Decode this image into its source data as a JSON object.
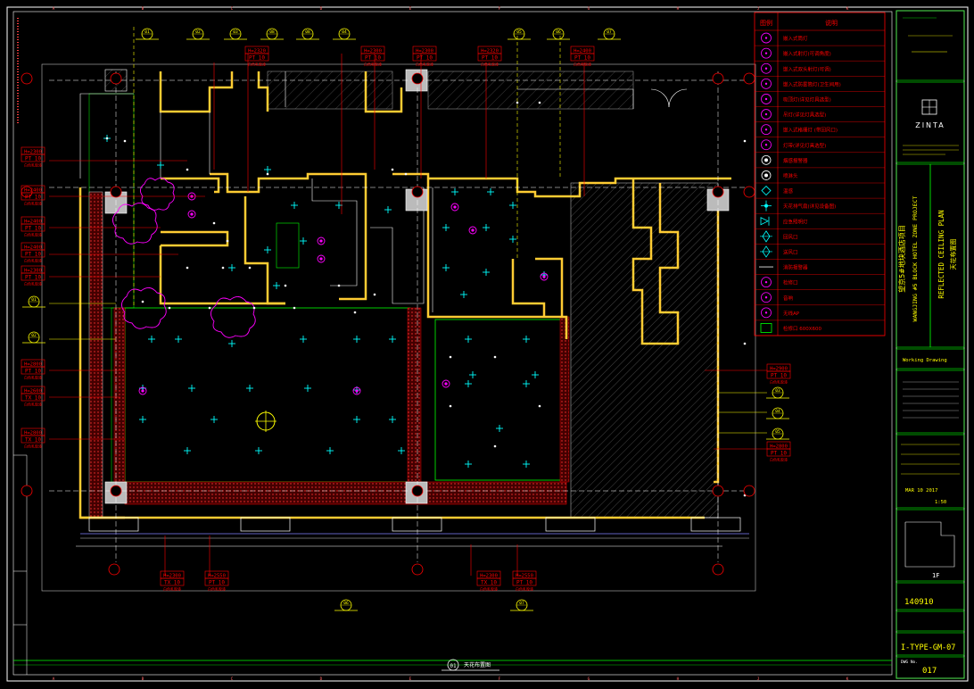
{
  "drawing": {
    "type": "reflected-ceiling-plan",
    "title_main": "REFLECTED CEILING PLAN",
    "title_sub": "天花布置图",
    "project_en": "WANGJING #5 BLOCK HOTEL ZONE PROJECT",
    "project_cn": "望京5#地块酒店项目",
    "firm": "ZINTA",
    "area_label": "Working Drawing",
    "project_no": "140910",
    "drawing_no": "I-TYPE-GM-07",
    "sheet_no": "017",
    "date": "MAR 10 2017",
    "level": "1F",
    "scale": "1:50",
    "sheet_label": "DWG No."
  },
  "legend": {
    "header_symbol": "图例",
    "header_desc": "说明",
    "items": [
      {
        "icon": "circle-f-icon",
        "color": "#ff00ff",
        "desc": "嵌入式筒灯"
      },
      {
        "icon": "circle-a-icon",
        "color": "#ff00ff",
        "desc": "嵌入式射灯(可调角度)"
      },
      {
        "icon": "circle-b-icon",
        "color": "#ff00ff",
        "desc": "嵌入式双头射灯(可调)"
      },
      {
        "icon": "circle-c-icon",
        "color": "#ff00ff",
        "desc": "嵌入式防雾筒灯(卫生间用)"
      },
      {
        "icon": "circle-d-icon",
        "color": "#ff00ff",
        "desc": "吸顶灯(详见灯具选型)"
      },
      {
        "icon": "circle-e-icon",
        "color": "#ff00ff",
        "desc": "吊灯(详见灯具选型)"
      },
      {
        "icon": "circle-g-icon",
        "color": "#ff00ff",
        "desc": "嵌入式格栅灯 (带回风口)"
      },
      {
        "icon": "circle-h-icon",
        "color": "#ff00ff",
        "desc": "灯带(详见灯具选型)"
      },
      {
        "icon": "speaker-icon",
        "color": "#ffffff",
        "desc": "烟感报警器"
      },
      {
        "icon": "sprinkler-icon",
        "color": "#ffffff",
        "desc": "喷淋头"
      },
      {
        "icon": "diamond-icon",
        "color": "#00ffff",
        "desc": "温感"
      },
      {
        "icon": "cross-icon",
        "color": "#00ffff",
        "desc": "天花排气扇(详见设备图)"
      },
      {
        "icon": "exit-icon",
        "color": "#00ffff",
        "desc": "应急照明灯"
      },
      {
        "icon": "vent-icon",
        "color": "#00ffff",
        "desc": "回风口"
      },
      {
        "icon": "supply-icon",
        "color": "#00ffff",
        "desc": "送风口"
      },
      {
        "icon": "line-icon",
        "color": "#ffffff",
        "desc": "消防报警器"
      },
      {
        "icon": "circle-p-icon",
        "color": "#ff00ff",
        "desc": "检修口"
      },
      {
        "icon": "circle-s-icon",
        "color": "#ff00ff",
        "desc": "音响"
      },
      {
        "icon": "circle-w-icon",
        "color": "#ff00ff",
        "desc": "无线AP"
      },
      {
        "icon": "square-icon",
        "color": "#00ff00",
        "desc": "检修口 600X600"
      }
    ]
  },
  "ceiling_tags": {
    "top": [
      {
        "h": "H=2320",
        "m": "PT 10",
        "s": "白色乳胶漆"
      },
      {
        "h": "H=2300",
        "m": "PT 10",
        "s": "白色乳胶漆"
      },
      {
        "h": "H=2300",
        "m": "PT 10",
        "s": "白色乳胶漆"
      },
      {
        "h": "H=2320",
        "m": "PT 10",
        "s": "白色乳胶漆"
      },
      {
        "h": "H=2400",
        "m": "PT 10",
        "s": "白色乳胶漆"
      }
    ],
    "left": [
      {
        "h": "H=2300",
        "m": "PT 10",
        "s": "白色乳胶漆"
      },
      {
        "h": "H=2400",
        "m": "PT 10",
        "s": "白色乳胶漆"
      },
      {
        "h": "H=2400",
        "m": "PT 10",
        "s": "白色乳胶漆"
      },
      {
        "h": "H=2400",
        "m": "PT 10",
        "s": "白色乳胶漆"
      },
      {
        "h": "H=2300",
        "m": "PT 10",
        "s": "白色乳胶漆"
      },
      {
        "h": "H=2800",
        "m": "PT 10",
        "s": "白色乳胶漆"
      },
      {
        "h": "H=2600",
        "m": "TX 10",
        "s": "白色乳胶漆"
      },
      {
        "h": "H=2800",
        "m": "TX 10",
        "s": "白色乳胶漆"
      }
    ],
    "right": [
      {
        "h": "H=2900",
        "m": "PT 10",
        "s": "白色乳胶漆"
      },
      {
        "h": "H=2800",
        "m": "PT 10",
        "s": "白色乳胶漆"
      }
    ],
    "bottom": [
      {
        "h": "H=2300",
        "m": "TX 10",
        "s": "白色乳胶漆"
      },
      {
        "h": "H=2550",
        "m": "PT 10",
        "s": "白色乳胶漆"
      },
      {
        "h": "H=2300",
        "m": "TX 10",
        "s": "白色乳胶漆"
      },
      {
        "h": "H=2550",
        "m": "PT 10",
        "s": "白色乳胶漆"
      }
    ]
  },
  "section_marks": [
    "01",
    "02",
    "03",
    "04",
    "05",
    "06",
    "07",
    "08"
  ],
  "grid_labels": [
    "A",
    "B",
    "C",
    "D",
    "E",
    "F",
    "G",
    "H",
    "J",
    "K"
  ],
  "colors": {
    "bg": "#000000",
    "wall": "#ffff00",
    "annotation": "#ff0000",
    "ceiling": "#00ff00",
    "fixture": "#ff00ff",
    "device": "#00ffff",
    "frame": "#ffffff"
  }
}
